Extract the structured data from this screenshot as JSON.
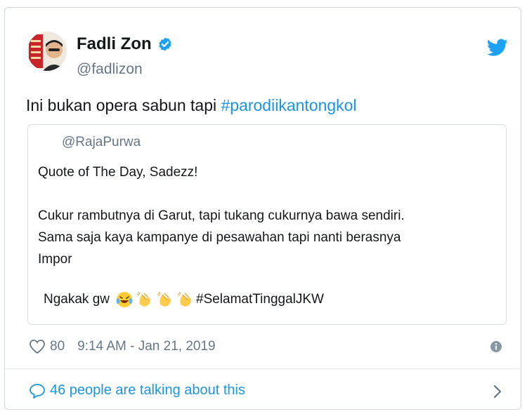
{
  "author": {
    "name": "Fadli Zon",
    "handle": "@fadlizon"
  },
  "tweet": {
    "text_plain": "Ini bukan opera sabun tapi ",
    "hashtag": "#parodiikantongkol"
  },
  "quoted": {
    "handle": "@RajaPurwa",
    "line1": "Quote of The Day, Sadezz!",
    "line2": "Cukur rambutnya di Garut, tapi tukang cukurnya bawa sendiri.",
    "line3": "Sama saja kaya kampanye di pesawahan tapi nanti berasnya",
    "line4": "Impor",
    "last_prefix": "Ngakak gw",
    "last_hashtag": "#SelamatTinggalJKW"
  },
  "meta": {
    "likes": "80",
    "timestamp": "9:14 AM - Jan 21, 2019"
  },
  "footer": {
    "talking": "46 people are talking about this"
  },
  "colors": {
    "link": "#1b95e0",
    "muted": "#657786",
    "verified": "#1da1f2"
  },
  "icons": [
    "twitter-bird-icon",
    "verified-badge-icon",
    "heart-icon",
    "info-icon",
    "speech-bubble-icon",
    "chevron-right-icon",
    "laughing-crying-emoji",
    "clapping-hands-emoji"
  ]
}
